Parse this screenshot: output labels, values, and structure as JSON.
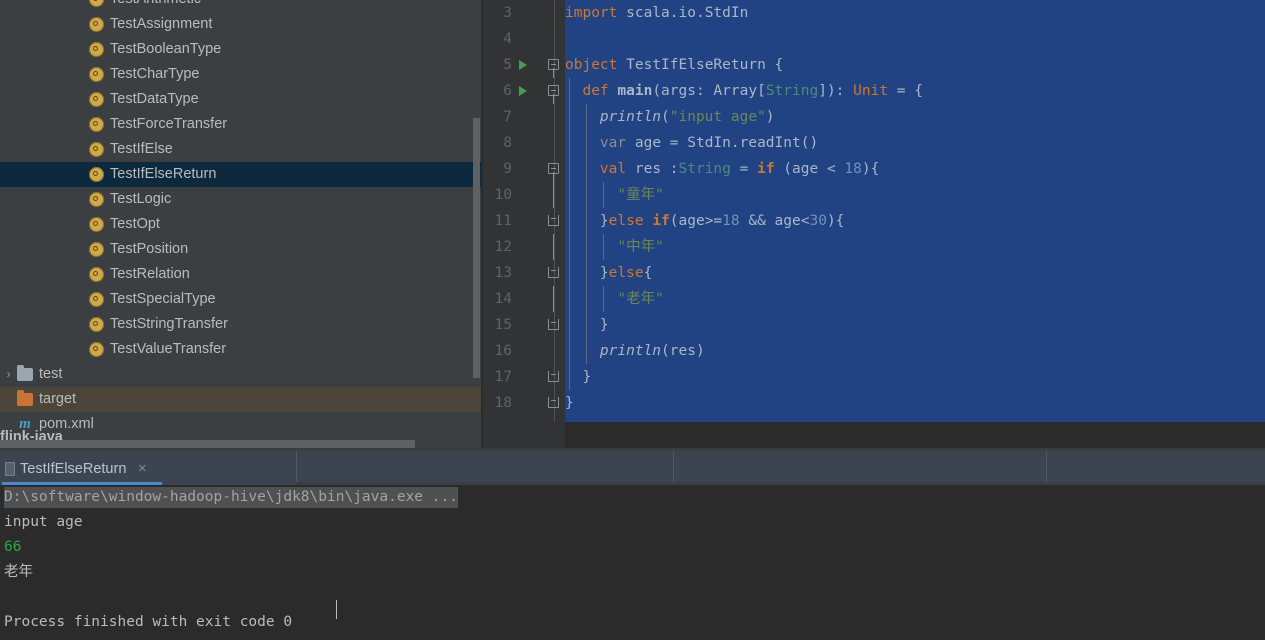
{
  "sidebar": {
    "tree_items": [
      {
        "label": "TestArithmetic",
        "icon": "scala-object-icon",
        "state": "partial-top"
      },
      {
        "label": "TestAssignment",
        "icon": "scala-object-icon",
        "state": "normal"
      },
      {
        "label": "TestBooleanType",
        "icon": "scala-object-icon",
        "state": "normal"
      },
      {
        "label": "TestCharType",
        "icon": "scala-object-icon",
        "state": "normal"
      },
      {
        "label": "TestDataType",
        "icon": "scala-object-icon",
        "state": "normal"
      },
      {
        "label": "TestForceTransfer",
        "icon": "scala-object-icon",
        "state": "normal"
      },
      {
        "label": "TestIfElse",
        "icon": "scala-object-icon",
        "state": "normal"
      },
      {
        "label": "TestIfElseReturn",
        "icon": "scala-object-icon",
        "state": "selected"
      },
      {
        "label": "TestLogic",
        "icon": "scala-object-icon",
        "state": "normal"
      },
      {
        "label": "TestOpt",
        "icon": "scala-object-icon",
        "state": "normal"
      },
      {
        "label": "TestPosition",
        "icon": "scala-object-icon",
        "state": "normal"
      },
      {
        "label": "TestRelation",
        "icon": "scala-object-icon",
        "state": "normal"
      },
      {
        "label": "TestSpecialType",
        "icon": "scala-object-icon",
        "state": "normal"
      },
      {
        "label": "TestStringTransfer",
        "icon": "scala-object-icon",
        "state": "normal"
      },
      {
        "label": "TestValueTransfer",
        "icon": "scala-object-icon",
        "state": "normal"
      }
    ],
    "folder_items": [
      {
        "label": "test",
        "icon": "folder-icon",
        "chevron": "›",
        "highlight": false
      },
      {
        "label": "target",
        "icon": "folder-orange-icon",
        "chevron": "",
        "highlight": true
      },
      {
        "label": "pom.xml",
        "icon": "maven-icon",
        "chevron": "",
        "highlight": false
      }
    ],
    "clipped_label": "flink-java"
  },
  "editor": {
    "lines": [
      {
        "number": "3",
        "run": false,
        "fold": "none",
        "tokens": [
          {
            "t": "import",
            "c": "kw"
          },
          {
            "t": " scala.io.StdIn",
            "c": "plain"
          }
        ]
      },
      {
        "number": "4",
        "run": false,
        "fold": "none",
        "tokens": []
      },
      {
        "number": "5",
        "run": true,
        "fold": "start",
        "tokens": [
          {
            "t": "object",
            "c": "kw"
          },
          {
            "t": " ",
            "c": "plain"
          },
          {
            "t": "TestIfElseReturn",
            "c": "plain"
          },
          {
            "t": " {",
            "c": "plain"
          }
        ]
      },
      {
        "number": "6",
        "run": true,
        "fold": "start",
        "indent": 1,
        "tokens": [
          {
            "t": "  ",
            "c": "plain"
          },
          {
            "t": "def",
            "c": "kw"
          },
          {
            "t": " ",
            "c": "plain"
          },
          {
            "t": "main",
            "c": "fn"
          },
          {
            "t": "(args: Array[",
            "c": "plain"
          },
          {
            "t": "String",
            "c": "type"
          },
          {
            "t": "]): ",
            "c": "plain"
          },
          {
            "t": "Unit",
            "c": "kw"
          },
          {
            "t": " = {",
            "c": "plain"
          }
        ]
      },
      {
        "number": "7",
        "run": false,
        "fold": "none",
        "indent": 2,
        "tokens": [
          {
            "t": "    ",
            "c": "plain"
          },
          {
            "t": "println",
            "c": "ital"
          },
          {
            "t": "(",
            "c": "plain"
          },
          {
            "t": "\"input age\"",
            "c": "str"
          },
          {
            "t": ")",
            "c": "plain"
          }
        ]
      },
      {
        "number": "8",
        "run": false,
        "fold": "none",
        "indent": 2,
        "tokens": [
          {
            "t": "    ",
            "c": "plain"
          },
          {
            "t": "var",
            "c": "varkw"
          },
          {
            "t": " age = StdIn.readInt()",
            "c": "plain"
          }
        ]
      },
      {
        "number": "9",
        "run": false,
        "fold": "start",
        "indent": 2,
        "tokens": [
          {
            "t": "    ",
            "c": "plain"
          },
          {
            "t": "val",
            "c": "kw"
          },
          {
            "t": " res :",
            "c": "plain"
          },
          {
            "t": "String",
            "c": "type"
          },
          {
            "t": " = ",
            "c": "plain"
          },
          {
            "t": "if",
            "c": "kw2"
          },
          {
            "t": " (age < ",
            "c": "plain"
          },
          {
            "t": "18",
            "c": "num"
          },
          {
            "t": "){",
            "c": "plain"
          }
        ]
      },
      {
        "number": "10",
        "run": false,
        "fold": "bar",
        "indent": 3,
        "tokens": [
          {
            "t": "      ",
            "c": "plain"
          },
          {
            "t": "\"童年\"",
            "c": "str"
          }
        ]
      },
      {
        "number": "11",
        "run": false,
        "fold": "end",
        "indent": 2,
        "tokens": [
          {
            "t": "    }",
            "c": "plain"
          },
          {
            "t": "else",
            "c": "kw"
          },
          {
            "t": " ",
            "c": "plain"
          },
          {
            "t": "if",
            "c": "kw2"
          },
          {
            "t": "(age>=",
            "c": "plain"
          },
          {
            "t": "18",
            "c": "num"
          },
          {
            "t": " && age<",
            "c": "plain"
          },
          {
            "t": "30",
            "c": "num"
          },
          {
            "t": "){",
            "c": "plain"
          }
        ]
      },
      {
        "number": "12",
        "run": false,
        "fold": "bar",
        "indent": 3,
        "tokens": [
          {
            "t": "      ",
            "c": "plain"
          },
          {
            "t": "\"中年\"",
            "c": "str"
          }
        ]
      },
      {
        "number": "13",
        "run": false,
        "fold": "end",
        "indent": 2,
        "tokens": [
          {
            "t": "    }",
            "c": "plain"
          },
          {
            "t": "else",
            "c": "kw"
          },
          {
            "t": "{",
            "c": "plain"
          }
        ]
      },
      {
        "number": "14",
        "run": false,
        "fold": "bar",
        "indent": 3,
        "tokens": [
          {
            "t": "      ",
            "c": "plain"
          },
          {
            "t": "\"老年\"",
            "c": "str"
          }
        ]
      },
      {
        "number": "15",
        "run": false,
        "fold": "end",
        "indent": 2,
        "tokens": [
          {
            "t": "    }",
            "c": "plain"
          }
        ]
      },
      {
        "number": "16",
        "run": false,
        "fold": "none",
        "indent": 2,
        "tokens": [
          {
            "t": "    ",
            "c": "plain"
          },
          {
            "t": "println",
            "c": "ital"
          },
          {
            "t": "(res)",
            "c": "plain"
          }
        ]
      },
      {
        "number": "17",
        "run": false,
        "fold": "end",
        "indent": 1,
        "tokens": [
          {
            "t": "  }",
            "c": "plain"
          }
        ]
      },
      {
        "number": "18",
        "run": false,
        "fold": "end",
        "tokens": [
          {
            "t": "}",
            "c": "plain"
          }
        ]
      }
    ],
    "selection_color": "#214283"
  },
  "run_panel": {
    "tab": {
      "label": "TestIfElseReturn",
      "close_glyph": "×",
      "icon": "run-config-icon"
    },
    "console_lines": [
      {
        "text": "D:\\software\\window-hadoop-hive\\jdk8\\bin\\java.exe ...",
        "style": "command"
      },
      {
        "text": "input age",
        "style": "normal"
      },
      {
        "text": "66",
        "style": "green"
      },
      {
        "text": "老年",
        "style": "normal"
      },
      {
        "text": "",
        "style": "normal"
      },
      {
        "text": "Process finished with exit code 0",
        "style": "normal"
      }
    ]
  },
  "colors": {
    "accent_blue": "#4a88c7",
    "selection_blue": "#214283",
    "tree_selected": "#0d293e",
    "target_highlight": "#4b4639",
    "console_green": "#2aa83f",
    "keyword_orange": "#cc7832",
    "string_green": "#6a8759",
    "number_blue": "#6897bb",
    "type_teal": "#4e8c78",
    "run_arrow_green": "#499c54"
  }
}
